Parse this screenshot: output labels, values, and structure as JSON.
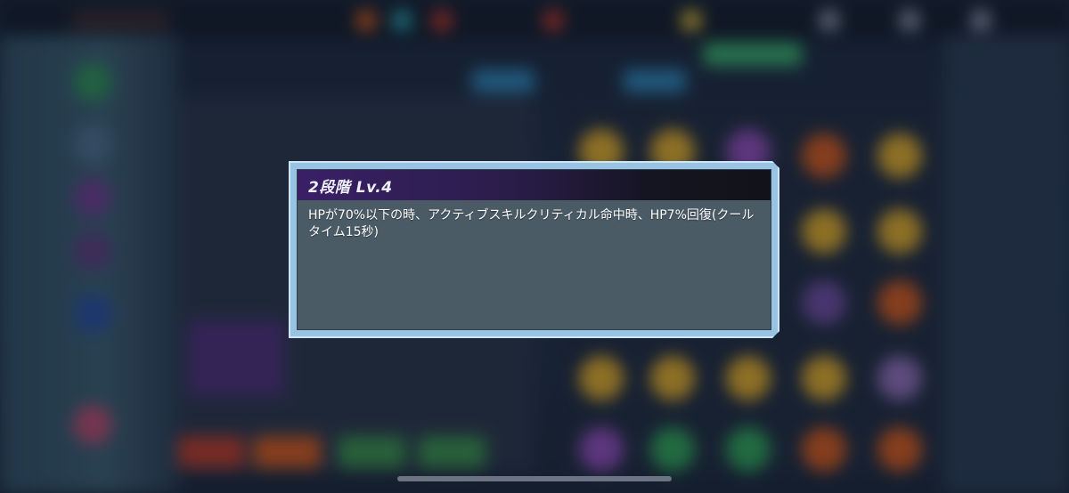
{
  "dialog": {
    "title": "2段階 Lv.4",
    "description": "HPが70%以下の時、アクティブスキルクリティカル命中時、HP7%回復(クールタイム15秒)"
  },
  "colors": {
    "frame": "#98c3e3",
    "panel": "#4a5b66",
    "header_start": "#3a1f66",
    "header_end": "#121319",
    "text": "#ffffff"
  }
}
